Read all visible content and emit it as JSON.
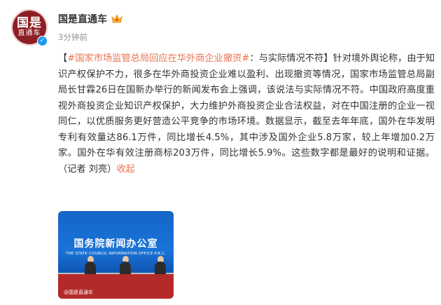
{
  "account": {
    "name": "国是直通车",
    "avatar_line1": "国是",
    "avatar_line2": "直通车",
    "time": "3分钟前"
  },
  "post": {
    "bracket_open": "【",
    "hashtag": "#国家市场监管总局回应在华外商企业撤资#",
    "body": "：与实际情况不符】针对境外舆论称，由于知识产权保护不力，很多在华外商投资企业难以盈利、出现撤资等情况，国家市场监管总局副局长甘霖26日在国新办举行的新闻发布会上强调，该说法与实际情况不符。中国政府高度重视外商投资企业知识产权保护，大力维护外商投资企业合法权益，对在中国注册的企业一视同仁，以优质服务更好营造公平竞争的市场环境。数据显示，截至去年年底，国外在华发明专利有效量达86.1万件，同比增长4.5%，其中涉及国外企业5.8万家，较上年增加0.2万家。国外在华有效注册商标203万件，同比增长5.9%。这些数字都是最好的说明和证据。（记者 刘亮）",
    "collapse": "收起"
  },
  "image": {
    "sign_cn": "国务院新闻办公室",
    "sign_en": "THE STATE COUNCIL INFORMATION OFFICE P.R.C.",
    "watermark": "@国是直通车"
  },
  "colors": {
    "link": "#eb7350",
    "verified": "#1e9bf0",
    "avatar_bg": "#8c1f24"
  },
  "icons": {
    "badge": "crown-icon",
    "verified": "verified-icon"
  }
}
